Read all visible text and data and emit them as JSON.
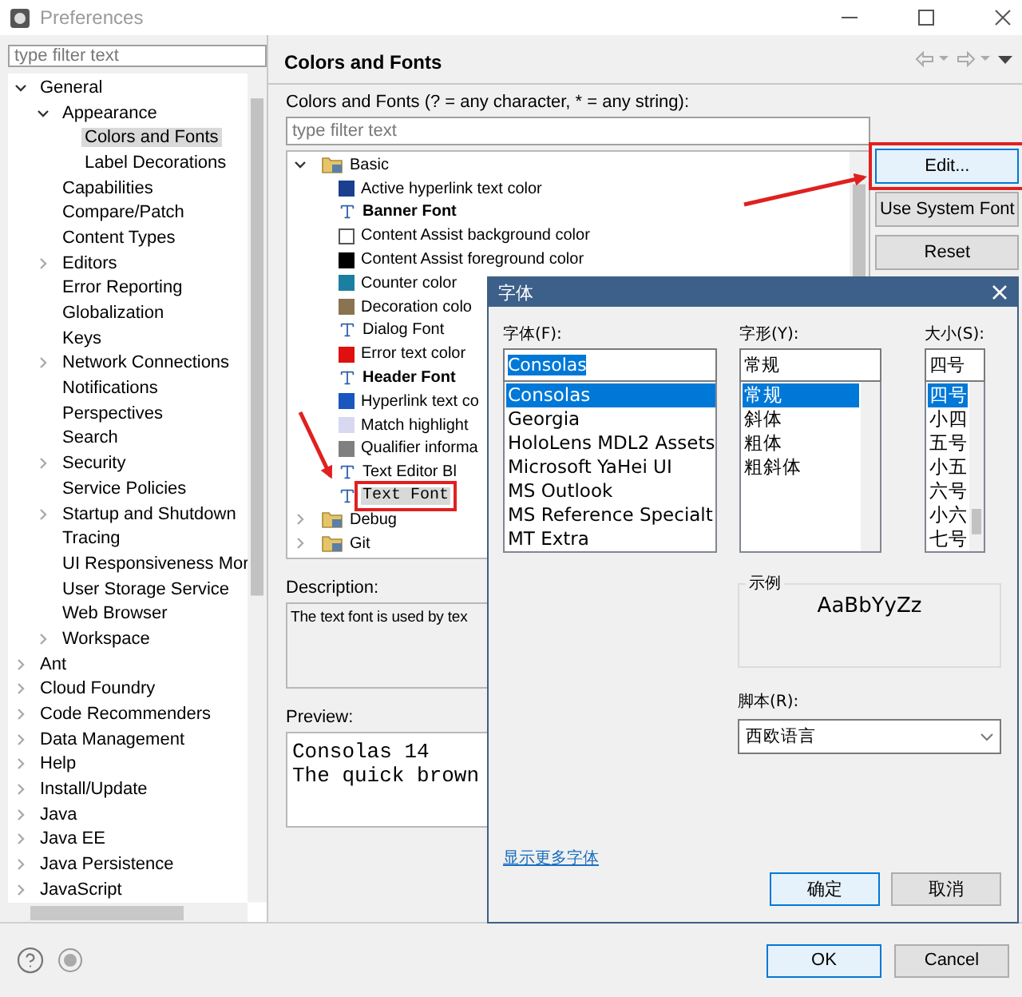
{
  "window": {
    "title": "Preferences"
  },
  "nav": {
    "filter_placeholder": "type filter text",
    "items": [
      {
        "label": "General",
        "expanded": true,
        "selected": false,
        "children": [
          {
            "label": "Appearance",
            "expanded": true,
            "selected": false,
            "children": [
              {
                "label": "Colors and Fonts",
                "selected": true
              },
              {
                "label": "Label Decorations",
                "selected": false
              }
            ]
          },
          {
            "label": "Capabilities",
            "selected": false
          },
          {
            "label": "Compare/Patch",
            "selected": false
          },
          {
            "label": "Content Types",
            "selected": false
          },
          {
            "label": "Editors",
            "expanded": false,
            "selected": false
          },
          {
            "label": "Error Reporting",
            "selected": false
          },
          {
            "label": "Globalization",
            "selected": false
          },
          {
            "label": "Keys",
            "selected": false
          },
          {
            "label": "Network Connections",
            "expanded": false,
            "selected": false
          },
          {
            "label": "Notifications",
            "selected": false
          },
          {
            "label": "Perspectives",
            "selected": false
          },
          {
            "label": "Search",
            "selected": false
          },
          {
            "label": "Security",
            "expanded": false,
            "selected": false
          },
          {
            "label": "Service Policies",
            "selected": false
          },
          {
            "label": "Startup and Shutdown",
            "expanded": false,
            "selected": false
          },
          {
            "label": "Tracing",
            "selected": false
          },
          {
            "label": "UI Responsiveness Mor",
            "selected": false
          },
          {
            "label": "User Storage Service",
            "selected": false
          },
          {
            "label": "Web Browser",
            "selected": false
          },
          {
            "label": "Workspace",
            "expanded": false,
            "selected": false
          }
        ]
      },
      {
        "label": "Ant",
        "expanded": false,
        "selected": false
      },
      {
        "label": "Cloud Foundry",
        "expanded": false,
        "selected": false
      },
      {
        "label": "Code Recommenders",
        "expanded": false,
        "selected": false
      },
      {
        "label": "Data Management",
        "expanded": false,
        "selected": false
      },
      {
        "label": "Help",
        "expanded": false,
        "selected": false
      },
      {
        "label": "Install/Update",
        "expanded": false,
        "selected": false
      },
      {
        "label": "Java",
        "expanded": false,
        "selected": false
      },
      {
        "label": "Java EE",
        "expanded": false,
        "selected": false
      },
      {
        "label": "Java Persistence",
        "expanded": false,
        "selected": false
      },
      {
        "label": "JavaScript",
        "expanded": false,
        "selected": false
      }
    ]
  },
  "page": {
    "title": "Colors and Fonts",
    "filter_label": "Colors and Fonts (? = any character, * = any string):",
    "filter_placeholder": "type filter text",
    "tree": [
      {
        "label": "Basic",
        "expanded": true,
        "children": [
          {
            "label": "Active hyperlink text color",
            "kind": "color",
            "color": "#1a3f8f",
            "bold": false,
            "selected": false
          },
          {
            "label": "Banner Font",
            "kind": "font",
            "bold": true,
            "selected": false
          },
          {
            "label": "Content Assist background color",
            "kind": "color",
            "color": "#ffffff",
            "bold": false,
            "selected": false
          },
          {
            "label": "Content Assist foreground color",
            "kind": "color",
            "color": "#000000",
            "bold": false,
            "selected": false
          },
          {
            "label": "Counter color",
            "kind": "color",
            "color": "#1a7fa0",
            "bold": false,
            "selected": false
          },
          {
            "label": "Decoration colo",
            "kind": "color",
            "color": "#8a7350",
            "bold": false,
            "selected": false
          },
          {
            "label": "Dialog Font",
            "kind": "font",
            "bold": false,
            "selected": false
          },
          {
            "label": "Error text color",
            "kind": "color",
            "color": "#e01010",
            "bold": false,
            "selected": false
          },
          {
            "label": "Header Font",
            "kind": "font",
            "bold": true,
            "selected": false
          },
          {
            "label": "Hyperlink text co",
            "kind": "color",
            "color": "#1a56c0",
            "bold": false,
            "selected": false
          },
          {
            "label": "Match highlight",
            "kind": "color",
            "color": "#d8d8f0",
            "bold": false,
            "selected": false
          },
          {
            "label": "Qualifier informa",
            "kind": "color",
            "color": "#808080",
            "bold": false,
            "selected": false
          },
          {
            "label": "Text Editor Bl",
            "kind": "font",
            "bold": false,
            "selected": false
          },
          {
            "label": "Text Font",
            "kind": "font",
            "bold": false,
            "selected": true,
            "annotated": true
          }
        ]
      },
      {
        "label": "Debug",
        "expanded": false
      },
      {
        "label": "Git",
        "expanded": false
      }
    ],
    "buttons": [
      {
        "label": "Edit...",
        "default": true,
        "annotated": true
      },
      {
        "label": "Use System Font",
        "default": false
      },
      {
        "label": "Reset",
        "default": false
      }
    ],
    "description_label": "Description:",
    "description": "The text font is used by tex",
    "preview_label": "Preview:",
    "preview": [
      "Consolas 14",
      "The quick brown"
    ]
  },
  "footer": {
    "buttons": [
      {
        "label": "OK",
        "default": true
      },
      {
        "label": "Cancel",
        "default": false
      }
    ]
  },
  "font_dialog": {
    "title": "字体",
    "columns": [
      {
        "label": "字体(F):",
        "value": "Consolas",
        "items": [
          {
            "label": "Consolas",
            "selected": true
          },
          {
            "label": "Georgia",
            "selected": false
          },
          {
            "label": "HoloLens MDL2 Assets",
            "selected": false
          },
          {
            "label": "Microsoft YaHei UI",
            "selected": false
          },
          {
            "label": "MS Outlook",
            "selected": false
          },
          {
            "label": "MS Reference Specialt",
            "selected": false
          },
          {
            "label": "MT Extra",
            "selected": false
          }
        ]
      },
      {
        "label": "字形(Y):",
        "value": "常规",
        "items": [
          {
            "label": "常规",
            "selected": true
          },
          {
            "label": "斜体",
            "selected": false
          },
          {
            "label": "粗体",
            "selected": false
          },
          {
            "label": "粗斜体",
            "selected": false
          }
        ]
      },
      {
        "label": "大小(S):",
        "value": "四号",
        "items": [
          {
            "label": "四号",
            "selected": true
          },
          {
            "label": "小四",
            "selected": false
          },
          {
            "label": "五号",
            "selected": false
          },
          {
            "label": "小五",
            "selected": false
          },
          {
            "label": "六号",
            "selected": false
          },
          {
            "label": "小六",
            "selected": false
          },
          {
            "label": "七号",
            "selected": false
          }
        ]
      }
    ],
    "sample_label": "示例",
    "sample": "AaBbYyZz",
    "script_label": "脚本(R):",
    "script": "西欧语言",
    "more_fonts_link": "显示更多字体",
    "buttons": [
      {
        "label": "确定",
        "default": true
      },
      {
        "label": "取消",
        "default": false
      }
    ]
  }
}
